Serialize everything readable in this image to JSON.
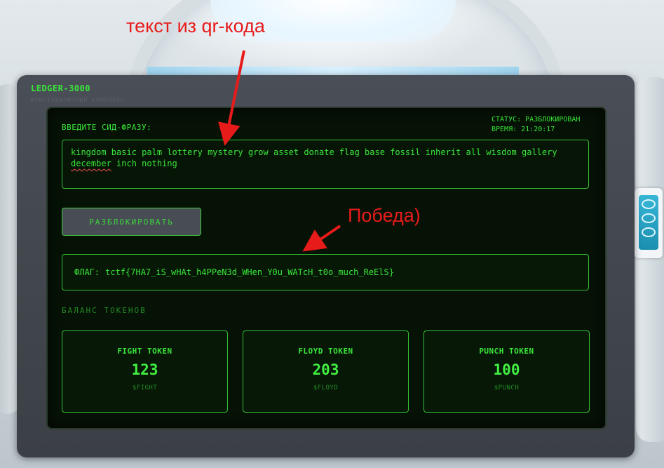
{
  "brand": {
    "title": "LEDGER-3000",
    "subtitle": "КРИПТОВАЛЮТНЫЙ КОМПЛЕКС"
  },
  "status": {
    "state": "СТАТУС: РАЗБЛОКИРОВАН",
    "time": "ВРЕМЯ: 21:20:17"
  },
  "seed": {
    "label": "ВВЕДИТЕ СИД-ФРАЗУ:",
    "text_before": "kingdom basic palm lottery mystery grow asset donate flag base fossil inherit all wisdom gallery ",
    "text_underlined": "december",
    "text_after": " inch nothing"
  },
  "unlock_button": {
    "label": "РАЗБЛОКИРОВАТЬ"
  },
  "flag": {
    "label": "ФЛАГ:",
    "value": "tctf{7HA7_iS_wHAt_h4PPeN3d_WHen_Y0u_WATcH_t0o_much_ReElS}"
  },
  "balance": {
    "title": "БАЛАНС ТОКЕНОВ",
    "tokens": [
      {
        "name": "FIGHT TOKEN",
        "amount": "123",
        "symbol": "$FIGHT"
      },
      {
        "name": "FLOYD TOKEN",
        "amount": "203",
        "symbol": "$FLOYD"
      },
      {
        "name": "PUNCH TOKEN",
        "amount": "100",
        "symbol": "$PUNCH"
      }
    ]
  },
  "annotations": {
    "qr_text": "текст из qr-кода",
    "victory": "Победа)"
  },
  "colors": {
    "terminal_green": "#39e639",
    "annotation_red": "#e81b1b"
  }
}
